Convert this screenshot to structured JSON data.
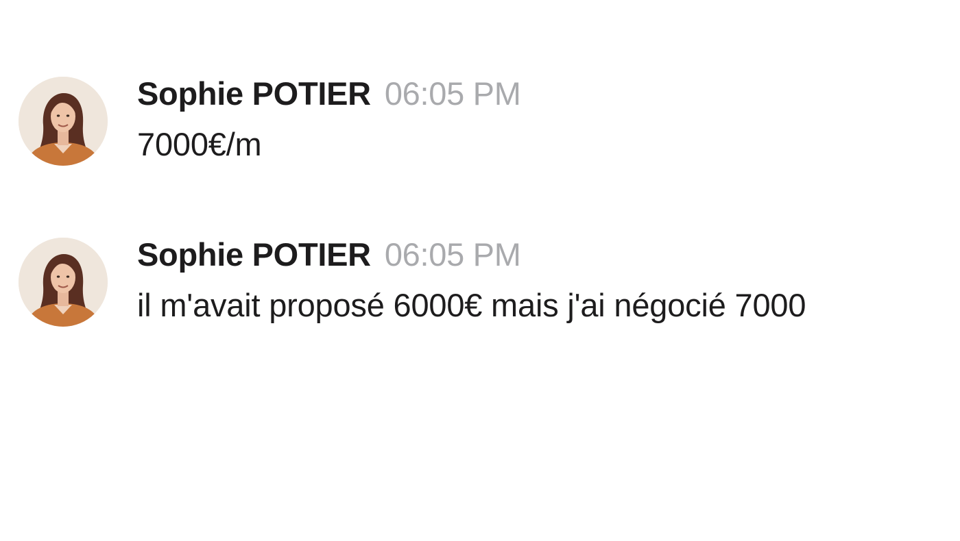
{
  "messages": [
    {
      "author": "Sophie POTIER",
      "time": "06:05 PM",
      "text": "7000€/m",
      "avatar_icon": "user-photo"
    },
    {
      "author": "Sophie POTIER",
      "time": "06:05 PM",
      "text": "il m'avait proposé 6000€ mais j'ai négocié 7000",
      "avatar_icon": "user-photo"
    }
  ],
  "colors": {
    "author": "#1d1c1d",
    "timestamp": "#a9aaad",
    "background": "#ffffff"
  }
}
